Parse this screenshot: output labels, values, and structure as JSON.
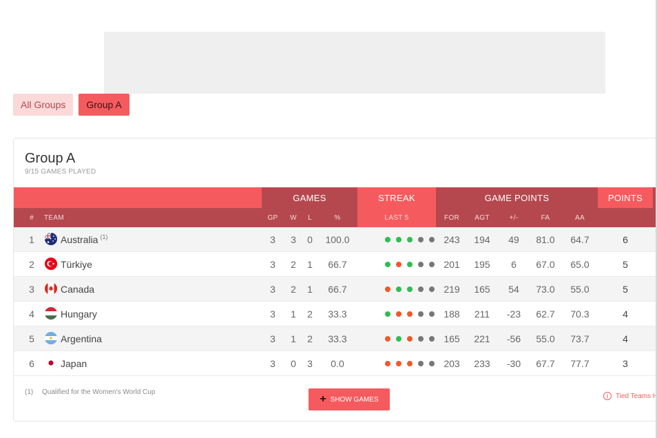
{
  "filters": [
    {
      "label": "All Groups",
      "active": false
    },
    {
      "label": "Group A",
      "active": true
    }
  ],
  "group": {
    "title": "Group A",
    "subtitle": "9/15 GAMES PLAYED"
  },
  "header_groups": {
    "games": "GAMES",
    "streak": "STREAK",
    "game_points": "GAME POINTS",
    "points": "POINTS"
  },
  "columns": {
    "rank": "#",
    "team": "TEAM",
    "gp": "GP",
    "w": "W",
    "l": "L",
    "pct": "%",
    "last5": "LAST 5",
    "for": "FOR",
    "agt": "AGT",
    "diff": "+/-",
    "fa": "FA",
    "aa": "AA"
  },
  "colors": {
    "accent": "#f55b5e",
    "accent_dark": "#b5484f",
    "win": "#2dbe4f",
    "loss": "#f0582b",
    "not_played": "#777777"
  },
  "rows": [
    {
      "rank": "1",
      "team": "Australia",
      "note": "(1)",
      "flag": "australia-flag-icon",
      "gp": "3",
      "w": "3",
      "l": "0",
      "pct": "100.0",
      "streak": [
        "W",
        "W",
        "W",
        "N",
        "N"
      ],
      "for": "243",
      "agt": "194",
      "diff": "49",
      "fa": "81.0",
      "aa": "64.7",
      "points": "6"
    },
    {
      "rank": "2",
      "team": "Türkiye",
      "note": "",
      "flag": "turkiye-flag-icon",
      "gp": "3",
      "w": "2",
      "l": "1",
      "pct": "66.7",
      "streak": [
        "W",
        "L",
        "W",
        "N",
        "N"
      ],
      "for": "201",
      "agt": "195",
      "diff": "6",
      "fa": "67.0",
      "aa": "65.0",
      "points": "5"
    },
    {
      "rank": "3",
      "team": "Canada",
      "note": "",
      "flag": "canada-flag-icon",
      "gp": "3",
      "w": "2",
      "l": "1",
      "pct": "66.7",
      "streak": [
        "L",
        "W",
        "W",
        "N",
        "N"
      ],
      "for": "219",
      "agt": "165",
      "diff": "54",
      "fa": "73.0",
      "aa": "55.0",
      "points": "5"
    },
    {
      "rank": "4",
      "team": "Hungary",
      "note": "",
      "flag": "hungary-flag-icon",
      "gp": "3",
      "w": "1",
      "l": "2",
      "pct": "33.3",
      "streak": [
        "W",
        "L",
        "L",
        "N",
        "N"
      ],
      "for": "188",
      "agt": "211",
      "diff": "-23",
      "fa": "62.7",
      "aa": "70.3",
      "points": "4"
    },
    {
      "rank": "5",
      "team": "Argentina",
      "note": "",
      "flag": "argentina-flag-icon",
      "gp": "3",
      "w": "1",
      "l": "2",
      "pct": "33.3",
      "streak": [
        "L",
        "W",
        "L",
        "N",
        "N"
      ],
      "for": "165",
      "agt": "221",
      "diff": "-56",
      "fa": "55.0",
      "aa": "73.7",
      "points": "4"
    },
    {
      "rank": "6",
      "team": "Japan",
      "note": "",
      "flag": "japan-flag-icon",
      "gp": "3",
      "w": "0",
      "l": "3",
      "pct": "0.0",
      "streak": [
        "L",
        "L",
        "L",
        "N",
        "N"
      ],
      "for": "203",
      "agt": "233",
      "diff": "-30",
      "fa": "67.7",
      "aa": "77.7",
      "points": "3"
    }
  ],
  "footer": {
    "footnote_mark": "(1)",
    "footnote_text": "Qualified for the Women's World Cup",
    "show_games_label": "SHOW GAMES",
    "tied_label": "Tied Teams H"
  }
}
